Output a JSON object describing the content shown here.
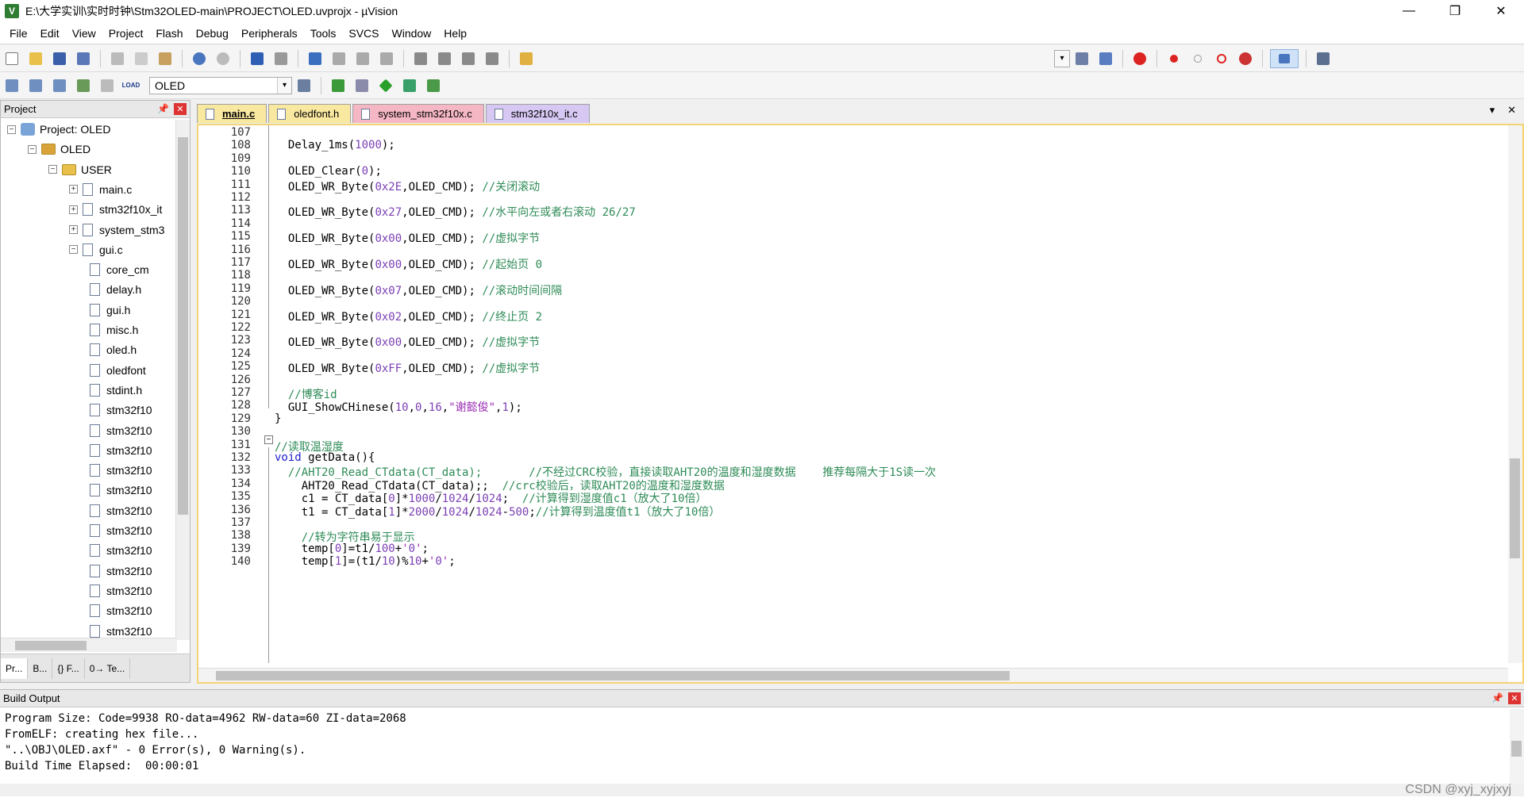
{
  "window": {
    "title": "E:\\大学实训\\实时时钟\\Stm32OLED-main\\PROJECT\\OLED.uvprojx - µVision",
    "app_icon": "V",
    "minimize": "—",
    "restore": "❐",
    "close": "✕"
  },
  "menu": [
    "File",
    "Edit",
    "View",
    "Project",
    "Flash",
    "Debug",
    "Peripherals",
    "Tools",
    "SVCS",
    "Window",
    "Help"
  ],
  "toolbar2": {
    "target": "OLED",
    "load_label": "LOAD"
  },
  "project_panel": {
    "header": "Project",
    "tree": [
      {
        "label": "Project: OLED",
        "level": 0,
        "expander": "⊟",
        "icon": "project"
      },
      {
        "label": "OLED",
        "level": 1,
        "expander": "⊟",
        "icon": "target"
      },
      {
        "label": "USER",
        "level": 2,
        "expander": "⊟",
        "icon": "folder"
      },
      {
        "label": "main.c",
        "level": 3,
        "expander": "⊞",
        "icon": "file"
      },
      {
        "label": "stm32f10x_it",
        "level": 3,
        "expander": "⊞",
        "icon": "file"
      },
      {
        "label": "system_stm3",
        "level": 3,
        "expander": "⊞",
        "icon": "file"
      },
      {
        "label": "gui.c",
        "level": 3,
        "expander": "⊟",
        "icon": "file"
      },
      {
        "label": "core_cm",
        "level": 4,
        "expander": "",
        "icon": "file"
      },
      {
        "label": "delay.h",
        "level": 4,
        "expander": "",
        "icon": "file"
      },
      {
        "label": "gui.h",
        "level": 4,
        "expander": "",
        "icon": "file"
      },
      {
        "label": "misc.h",
        "level": 4,
        "expander": "",
        "icon": "file"
      },
      {
        "label": "oled.h",
        "level": 4,
        "expander": "",
        "icon": "file"
      },
      {
        "label": "oledfont",
        "level": 4,
        "expander": "",
        "icon": "file"
      },
      {
        "label": "stdint.h",
        "level": 4,
        "expander": "",
        "icon": "file"
      },
      {
        "label": "stm32f10",
        "level": 4,
        "expander": "",
        "icon": "file"
      },
      {
        "label": "stm32f10",
        "level": 4,
        "expander": "",
        "icon": "file"
      },
      {
        "label": "stm32f10",
        "level": 4,
        "expander": "",
        "icon": "file"
      },
      {
        "label": "stm32f10",
        "level": 4,
        "expander": "",
        "icon": "file"
      },
      {
        "label": "stm32f10",
        "level": 4,
        "expander": "",
        "icon": "file"
      },
      {
        "label": "stm32f10",
        "level": 4,
        "expander": "",
        "icon": "file"
      },
      {
        "label": "stm32f10",
        "level": 4,
        "expander": "",
        "icon": "file"
      },
      {
        "label": "stm32f10",
        "level": 4,
        "expander": "",
        "icon": "file"
      },
      {
        "label": "stm32f10",
        "level": 4,
        "expander": "",
        "icon": "file"
      },
      {
        "label": "stm32f10",
        "level": 4,
        "expander": "",
        "icon": "file"
      },
      {
        "label": "stm32f10",
        "level": 4,
        "expander": "",
        "icon": "file"
      },
      {
        "label": "stm32f10",
        "level": 4,
        "expander": "",
        "icon": "file"
      }
    ],
    "tabs": [
      "Pr...",
      "B...",
      "{} F...",
      "0→ Te..."
    ]
  },
  "editor": {
    "tabs": [
      {
        "label": "main.c",
        "color": "#f9e8a0"
      },
      {
        "label": "oledfont.h",
        "color": "#f9e8a0"
      },
      {
        "label": "system_stm32f10x.c",
        "color": "#f5b7c4"
      },
      {
        "label": "stm32f10x_it.c",
        "color": "#d6c8f2"
      }
    ],
    "tab_controls": [
      "▾",
      "✕"
    ],
    "lines": [
      {
        "n": "107",
        "code": ""
      },
      {
        "n": "108",
        "code": "  Delay_1ms(1000);"
      },
      {
        "n": "109",
        "code": ""
      },
      {
        "n": "110",
        "code": "  OLED_Clear(0);"
      },
      {
        "n": "111",
        "code": "  OLED_WR_Byte(0x2E,OLED_CMD); //关闭滚动"
      },
      {
        "n": "112",
        "code": ""
      },
      {
        "n": "113",
        "code": "  OLED_WR_Byte(0x27,OLED_CMD); //水平向左或者右滚动 26/27"
      },
      {
        "n": "114",
        "code": ""
      },
      {
        "n": "115",
        "code": "  OLED_WR_Byte(0x00,OLED_CMD); //虚拟字节"
      },
      {
        "n": "116",
        "code": ""
      },
      {
        "n": "117",
        "code": "  OLED_WR_Byte(0x00,OLED_CMD); //起始页 0"
      },
      {
        "n": "118",
        "code": ""
      },
      {
        "n": "119",
        "code": "  OLED_WR_Byte(0x07,OLED_CMD); //滚动时间间隔"
      },
      {
        "n": "120",
        "code": ""
      },
      {
        "n": "121",
        "code": "  OLED_WR_Byte(0x02,OLED_CMD); //终止页 2"
      },
      {
        "n": "122",
        "code": ""
      },
      {
        "n": "123",
        "code": "  OLED_WR_Byte(0x00,OLED_CMD); //虚拟字节"
      },
      {
        "n": "124",
        "code": ""
      },
      {
        "n": "125",
        "code": "  OLED_WR_Byte(0xFF,OLED_CMD); //虚拟字节"
      },
      {
        "n": "126",
        "code": ""
      },
      {
        "n": "127",
        "code": "  //博客id"
      },
      {
        "n": "128",
        "code": "  GUI_ShowCHinese(10,0,16,\"谢懿俊\",1);"
      },
      {
        "n": "129",
        "code": "}"
      },
      {
        "n": "130",
        "code": ""
      },
      {
        "n": "131",
        "code": "//读取温湿度"
      },
      {
        "n": "132",
        "code": "void getData(){"
      },
      {
        "n": "133",
        "code": "  //AHT20_Read_CTdata(CT_data);       //不经过CRC校验，直接读取AHT20的温度和湿度数据    推荐每隔大于1S读一次"
      },
      {
        "n": "134",
        "code": "    AHT20_Read_CTdata(CT_data);;  //crc校验后，读取AHT20的温度和湿度数据"
      },
      {
        "n": "135",
        "code": "    c1 = CT_data[0]*1000/1024/1024;  //计算得到湿度值c1（放大了10倍）"
      },
      {
        "n": "136",
        "code": "    t1 = CT_data[1]*2000/1024/1024-500;//计算得到温度值t1（放大了10倍）"
      },
      {
        "n": "137",
        "code": ""
      },
      {
        "n": "138",
        "code": "    //转为字符串易于显示"
      },
      {
        "n": "139",
        "code": "    temp[0]=t1/100+'0';"
      },
      {
        "n": "140",
        "code": "    temp[1]=(t1/10)%10+'0';"
      }
    ]
  },
  "build_output": {
    "header": "Build Output",
    "lines": [
      "Program Size: Code=9938 RO-data=4962 RW-data=60 ZI-data=2068",
      "FromELF: creating hex file...",
      "\"..\\OBJ\\OLED.axf\" - 0 Error(s), 0 Warning(s).",
      "Build Time Elapsed:  00:00:01"
    ]
  },
  "watermark": "CSDN @xyj_xyjxyj"
}
